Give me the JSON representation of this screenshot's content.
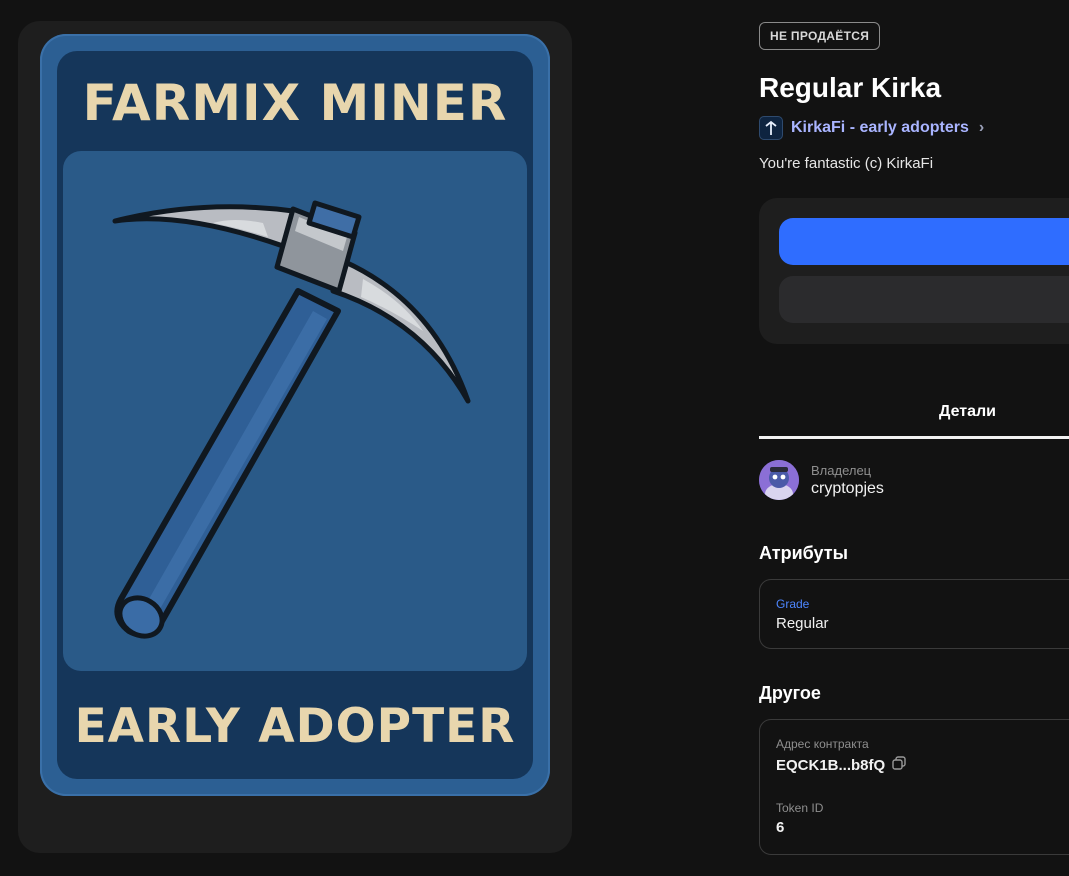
{
  "artwork": {
    "title": "FARMIX MINER",
    "subtitle": "EARLY ADOPTER",
    "colors": {
      "frame": "#2c5f93",
      "inner": "#15365a",
      "text": "#e8d6ad"
    }
  },
  "item": {
    "badge": "НЕ ПРОДАЁТСЯ",
    "name": "Regular Kirka",
    "collection": "KirkaFi - early adopters",
    "description": "You're fantastic (c) KirkaFi"
  },
  "tabs": [
    {
      "label": "Детали",
      "active": true
    }
  ],
  "owner": {
    "label": "Владелец",
    "name": "cryptopjes"
  },
  "attributes": {
    "title": "Атрибуты",
    "items": [
      {
        "key": "Grade",
        "value": "Regular"
      }
    ]
  },
  "other": {
    "title": "Другое",
    "contract_label": "Адрес контракта",
    "contract_value": "EQCK1B...b8fQ",
    "token_label": "Token ID",
    "token_value": "6"
  },
  "colors": {
    "accent": "#2f6dff",
    "link": "#a9b4ff",
    "background": "#121212"
  },
  "icons": [
    "pickaxe-illustration",
    "collection-logo-icon",
    "chevron-right-icon",
    "copy-icon"
  ]
}
